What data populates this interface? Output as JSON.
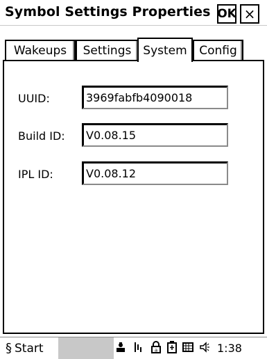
{
  "window": {
    "title": "Symbol Settings Properties",
    "ok_label": "OK",
    "close_label": "×"
  },
  "tabs": [
    {
      "label": "Wakeups",
      "active": false
    },
    {
      "label": "Settings",
      "active": false
    },
    {
      "label": "System",
      "active": true
    },
    {
      "label": "Config",
      "active": false
    }
  ],
  "fields": [
    {
      "label": "UUID:",
      "value": "3969fabfb4090018"
    },
    {
      "label": "Build ID:",
      "value": "V0.08.15"
    },
    {
      "label": "IPL ID:",
      "value": "V0.08.12"
    }
  ],
  "taskbar": {
    "start_label": "Start",
    "start_icon": "symbol-logo-icon",
    "tray_icons": [
      "network-icon",
      "connectivity-icon",
      "lock-icon",
      "battery-icon",
      "keyboard-icon",
      "speaker-icon"
    ],
    "clock": "1:38"
  }
}
